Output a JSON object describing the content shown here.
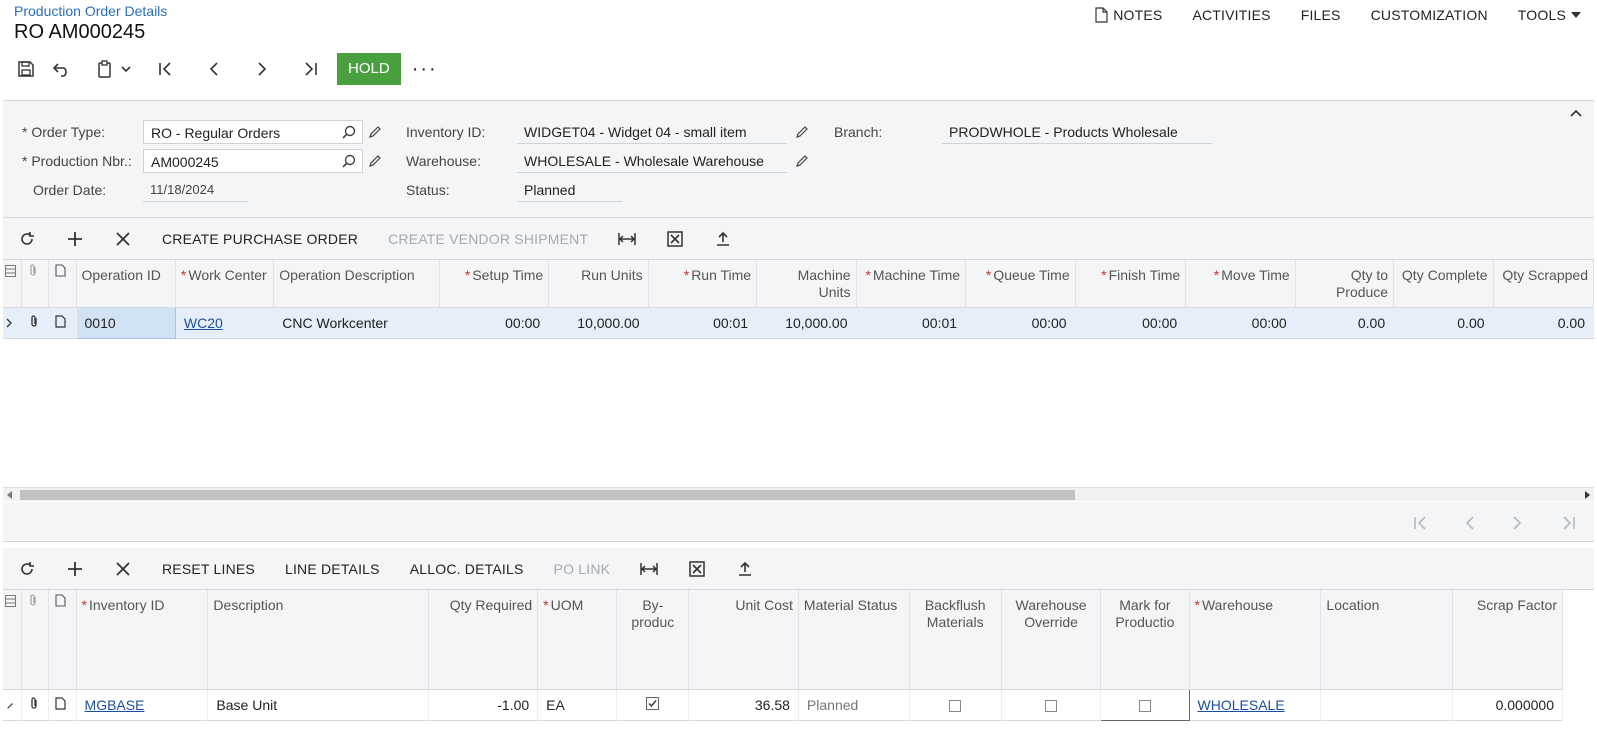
{
  "header": {
    "breadcrumb": "Production Order Details",
    "title": "RO AM000245",
    "menu": {
      "notes": "NOTES",
      "activities": "ACTIVITIES",
      "files": "FILES",
      "customization": "CUSTOMIZATION",
      "tools": "TOOLS"
    }
  },
  "toolbar": {
    "hold_label": "HOLD",
    "more_label": "···"
  },
  "form": {
    "order_type_label": "Order Type:",
    "order_type_value": "RO - Regular Orders",
    "production_nbr_label": "Production Nbr.:",
    "production_nbr_value": "AM000245",
    "order_date_label": "Order Date:",
    "order_date_value": "11/18/2024",
    "inventory_id_label": "Inventory ID:",
    "inventory_id_value": "WIDGET04 - Widget 04 - small item",
    "warehouse_label": "Warehouse:",
    "warehouse_value": "WHOLESALE - Wholesale Warehouse",
    "status_label": "Status:",
    "status_value": "Planned",
    "branch_label": "Branch:",
    "branch_value": "PRODWHOLE - Products Wholesale"
  },
  "operations": {
    "toolbar": {
      "create_po": "CREATE PURCHASE ORDER",
      "create_vendor_shipment": "CREATE VENDOR SHIPMENT"
    },
    "columns": [
      "Operation ID",
      "Work Center",
      "Operation Description",
      "Setup Time",
      "Run Units",
      "Run Time",
      "Machine Units",
      "Machine Time",
      "Queue Time",
      "Finish Time",
      "Move Time",
      "Qty to Produce",
      "Qty Complete",
      "Qty Scrapped"
    ],
    "rows": [
      {
        "operation_id": "0010",
        "work_center": "WC20",
        "description": "CNC Workcenter",
        "setup_time": "00:00",
        "run_units": "10,000.00",
        "run_time": "00:01",
        "machine_units": "10,000.00",
        "machine_time": "00:01",
        "queue_time": "00:00",
        "finish_time": "00:00",
        "move_time": "00:00",
        "qty_to_produce": "0.00",
        "qty_complete": "0.00",
        "qty_scrapped": "0.00"
      }
    ]
  },
  "materials": {
    "toolbar": {
      "reset_lines": "RESET LINES",
      "line_details": "LINE DETAILS",
      "alloc_details": "ALLOC. DETAILS",
      "po_link": "PO LINK"
    },
    "columns": [
      "Inventory ID",
      "Description",
      "Qty Required",
      "UOM",
      "By-produc",
      "Unit Cost",
      "Material Status",
      "Backflush Materials",
      "Warehouse Override",
      "Mark for Productio",
      "Warehouse",
      "Location",
      "Scrap Factor"
    ],
    "rows": [
      {
        "inventory_id": "MGBASE",
        "description": "Base Unit",
        "qty_required": "-1.00",
        "uom": "EA",
        "by_product": true,
        "unit_cost": "36.58",
        "material_status": "Planned",
        "backflush": false,
        "warehouse_override": false,
        "mark_for_production": false,
        "warehouse": "WHOLESALE",
        "location": "",
        "scrap_factor": "0.000000"
      }
    ]
  }
}
